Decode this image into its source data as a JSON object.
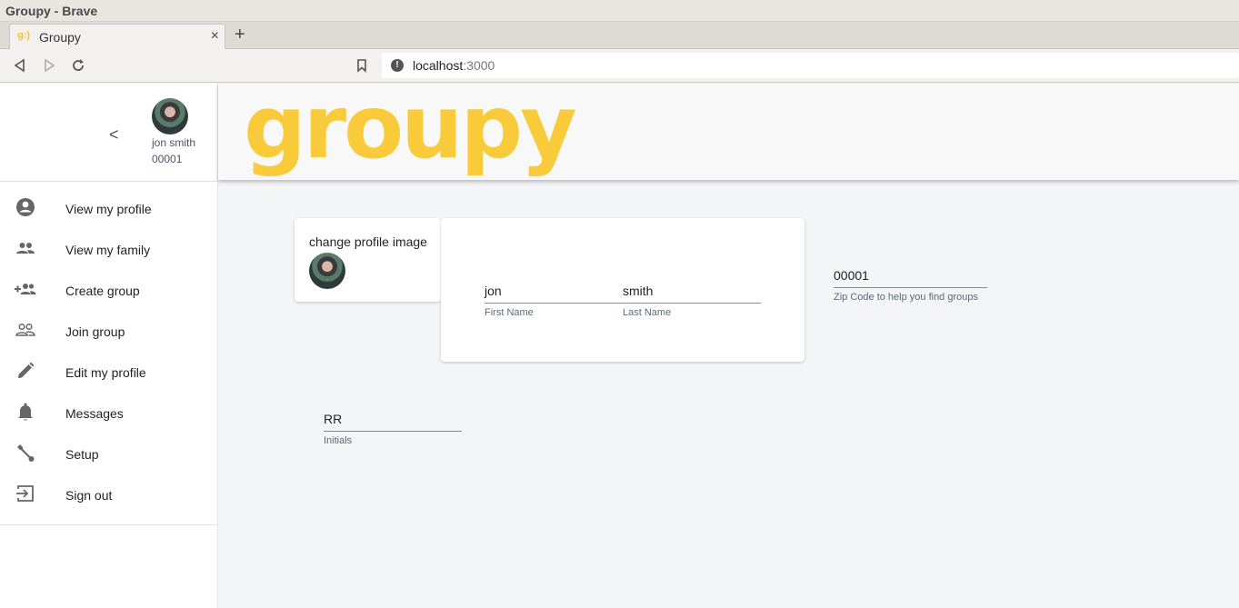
{
  "window": {
    "title": "Groupy - Brave"
  },
  "browser": {
    "tab_title": "Groupy",
    "url_host": "localhost",
    "url_port": ":3000"
  },
  "sidebar": {
    "user_name": "jon smith",
    "user_zip": "00001",
    "items": [
      {
        "label": "View my profile",
        "icon": "account-circle-icon"
      },
      {
        "label": "View my family",
        "icon": "people-icon"
      },
      {
        "label": "Create group",
        "icon": "group-add-icon"
      },
      {
        "label": "Join group",
        "icon": "people-outline-icon"
      },
      {
        "label": "Edit my profile",
        "icon": "pencil-icon"
      },
      {
        "label": "Messages",
        "icon": "bell-icon"
      },
      {
        "label": "Setup",
        "icon": "wrench-icon"
      },
      {
        "label": "Sign out",
        "icon": "sign-out-icon"
      }
    ]
  },
  "header": {
    "logo_text": "groupy",
    "logo_color": "#f9cb3a"
  },
  "profile": {
    "change_image_label": "change profile image",
    "first_name": {
      "value": "jon",
      "hint": "First Name"
    },
    "last_name": {
      "value": "smith",
      "hint": "Last Name"
    },
    "zip": {
      "value": "00001",
      "hint": "Zip Code to help you find groups"
    },
    "initials": {
      "value": "RR",
      "hint": "Initials"
    }
  }
}
